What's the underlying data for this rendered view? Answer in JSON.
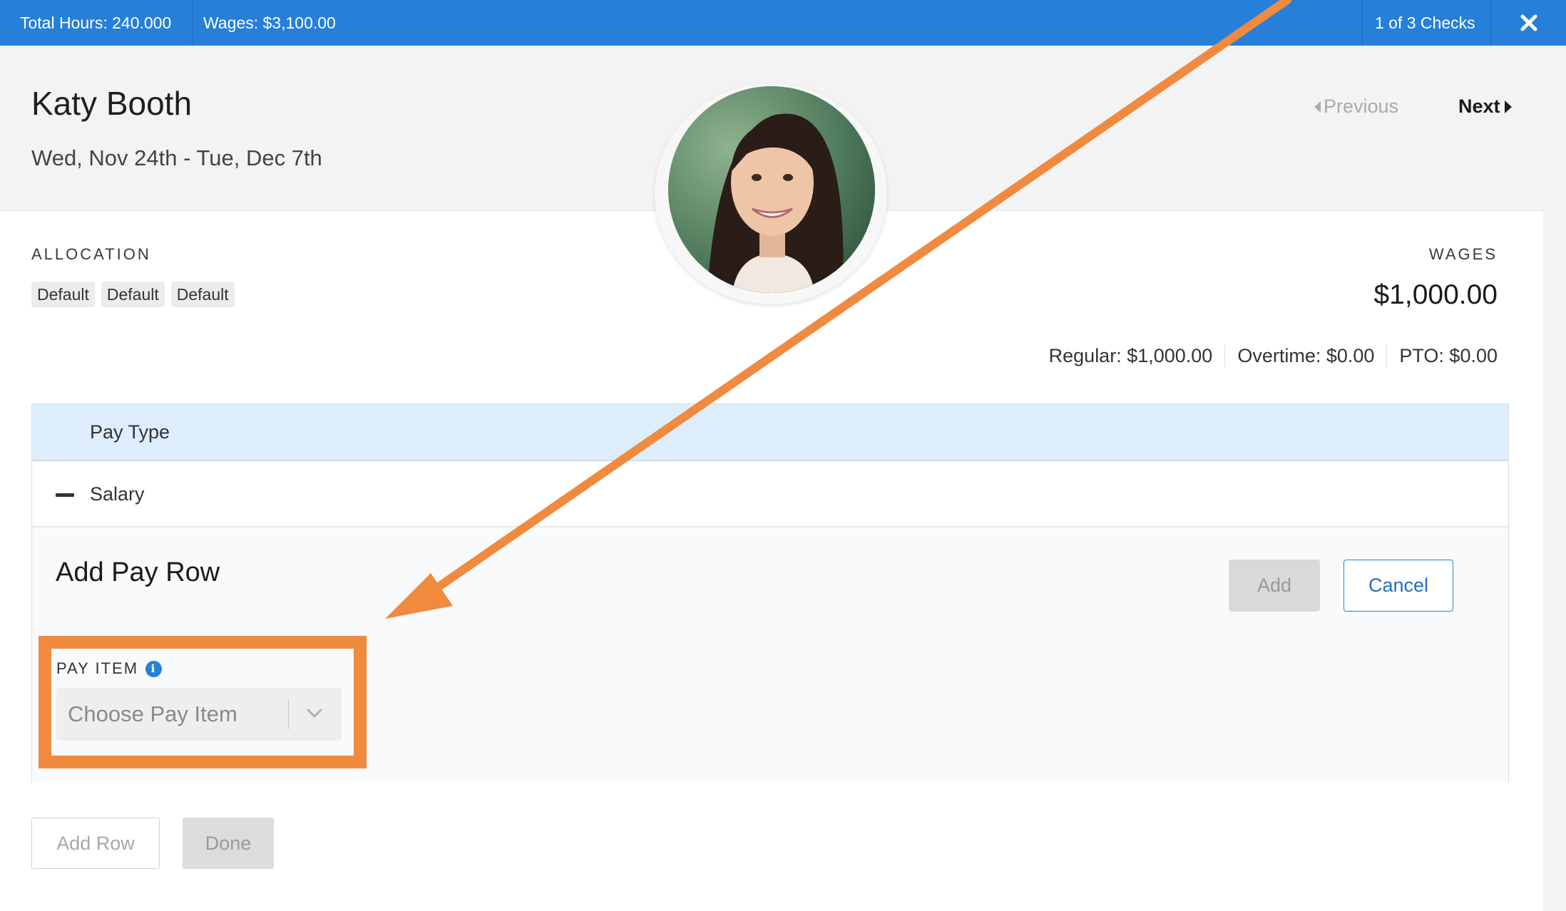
{
  "topbar": {
    "total_hours": "Total Hours: 240.000",
    "wages": "Wages: $3,100.00",
    "checks": "1 of 3 Checks",
    "close_icon": "close-icon"
  },
  "employee": {
    "name": "Katy Booth",
    "period": "Wed, Nov 24th - Tue, Dec 7th"
  },
  "nav": {
    "previous": "Previous",
    "next": "Next"
  },
  "allocation": {
    "label": "ALLOCATION",
    "tags": [
      "Default",
      "Default",
      "Default"
    ]
  },
  "wages": {
    "label": "WAGES",
    "amount": "$1,000.00",
    "breakdown": {
      "regular": "Regular: $1,000.00",
      "overtime": "Overtime: $0.00",
      "pto": "PTO: $0.00"
    }
  },
  "table": {
    "header": "Pay Type",
    "rows": [
      {
        "label": "Salary"
      }
    ]
  },
  "add_pay_row": {
    "title": "Add Pay Row",
    "pay_item_label": "PAY ITEM",
    "pay_item_placeholder": "Choose Pay Item",
    "add_label": "Add",
    "cancel_label": "Cancel"
  },
  "footer": {
    "add_row_label": "Add Row",
    "done_label": "Done"
  },
  "colors": {
    "topbar": "#2680d9",
    "annotation": "#f08a3e",
    "table_header": "#deedfc"
  }
}
